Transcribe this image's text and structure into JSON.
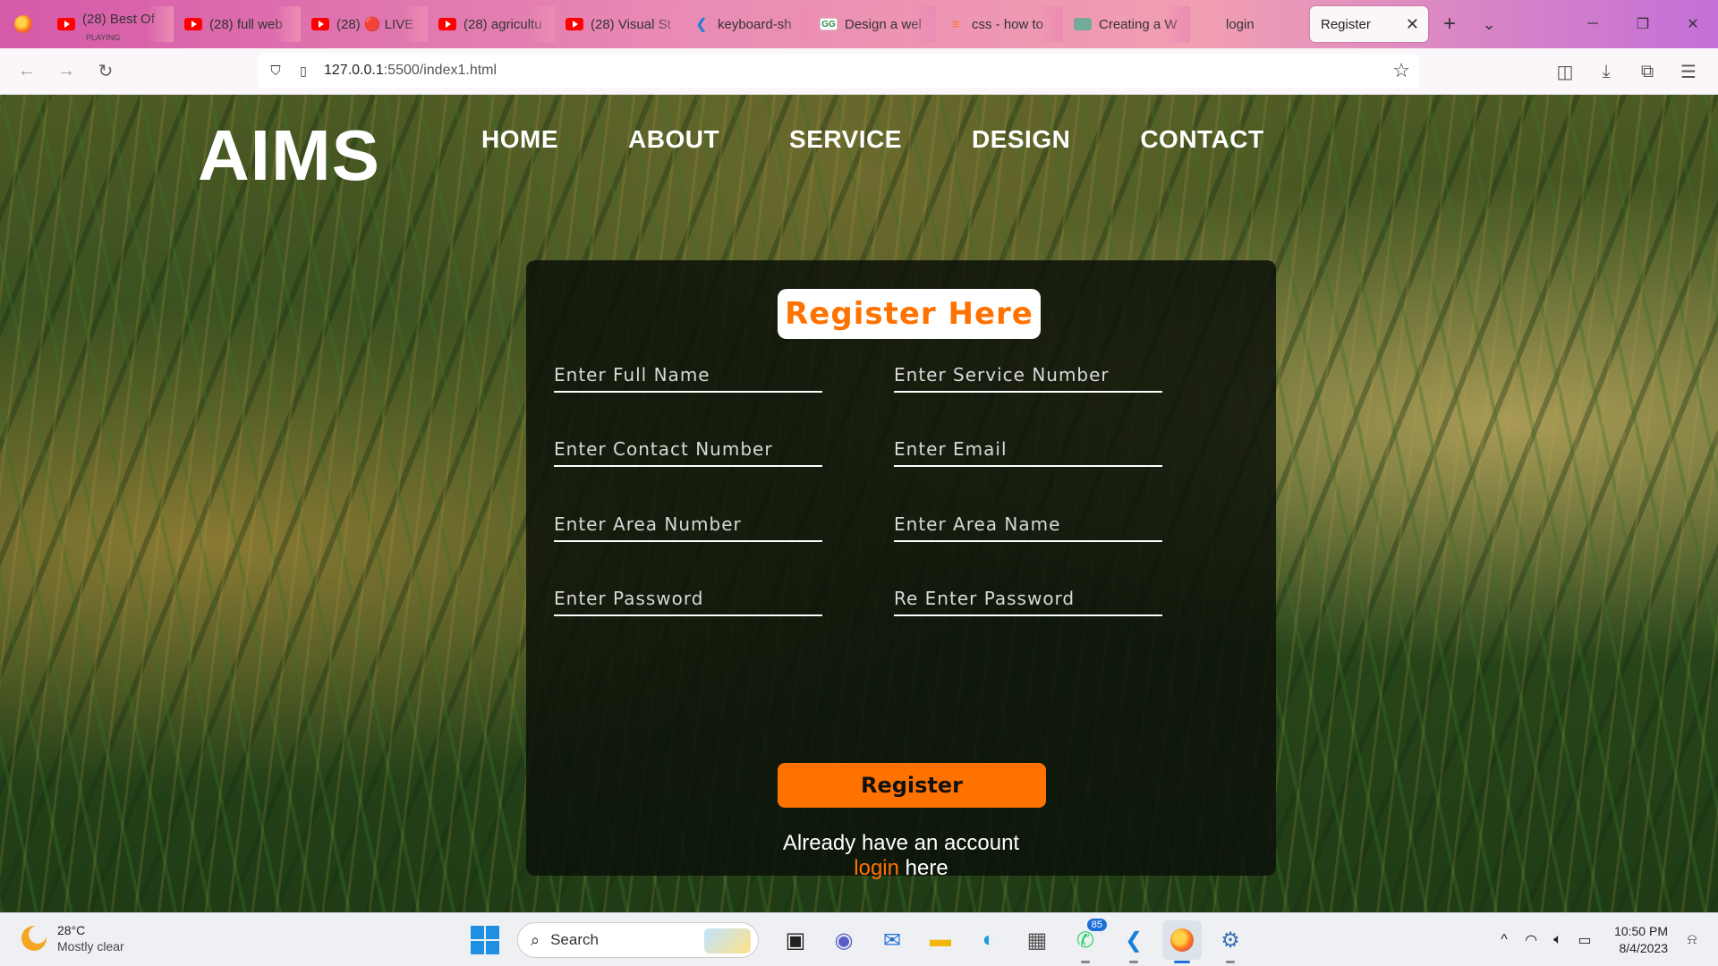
{
  "browser": {
    "tabs": [
      {
        "title": "(28) Best Of",
        "sub": "PLAYING",
        "icon": "youtube-icon"
      },
      {
        "title": "(28) full web",
        "icon": "youtube-icon"
      },
      {
        "title": "(28) 🔴 LIVE",
        "icon": "youtube-icon"
      },
      {
        "title": "(28) agricultu",
        "icon": "youtube-icon"
      },
      {
        "title": "(28) Visual St",
        "icon": "youtube-icon"
      },
      {
        "title": "keyboard-sh",
        "icon": "vscode-icon"
      },
      {
        "title": "Design a wel",
        "icon": "geeksforgeeks-icon"
      },
      {
        "title": "css - how to",
        "icon": "stackoverflow-icon"
      },
      {
        "title": "Creating a W",
        "icon": "chatgpt-icon"
      },
      {
        "title": "login",
        "icon": "blank-icon"
      }
    ],
    "active_tab": "Register",
    "url_host": "127.0.0.1",
    "url_path": ":5500/index1.html"
  },
  "site": {
    "logo": "AIMS",
    "nav": [
      "HOME",
      "ABOUT",
      "SERVICE",
      "DESIGN",
      "CONTACT"
    ]
  },
  "form": {
    "title": "Register Here",
    "fields": [
      {
        "placeholder": "Enter Full Name"
      },
      {
        "placeholder": "Enter Service Number"
      },
      {
        "placeholder": "Enter Contact Number"
      },
      {
        "placeholder": "Enter Email"
      },
      {
        "placeholder": "Enter Area Number"
      },
      {
        "placeholder": "Enter Area Name"
      },
      {
        "placeholder": "Enter Password"
      },
      {
        "placeholder": "Re Enter Password"
      }
    ],
    "submit": "Register",
    "footer_text": "Already have an account",
    "login_link": "login",
    "footer_suffix": " here"
  },
  "taskbar": {
    "temperature": "28°C",
    "weather": "Mostly clear",
    "search": "Search",
    "whatsapp_badge": "85",
    "time": "10:50 PM",
    "date": "8/4/2023"
  },
  "colors": {
    "accent": "#ff7200",
    "card": "rgba(12,18,9,0.86)"
  }
}
